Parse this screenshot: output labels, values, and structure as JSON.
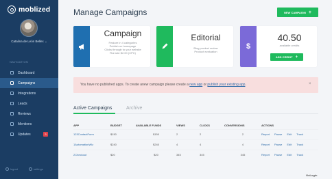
{
  "app": {
    "name": "moblized"
  },
  "user": {
    "name": "Catalina de León Bellec"
  },
  "nav": {
    "header": "NAVIGATION",
    "items": [
      {
        "label": "Dashboard"
      },
      {
        "label": "Campaigns"
      },
      {
        "label": "Integrations"
      },
      {
        "label": "Leads"
      },
      {
        "label": "Reviews"
      },
      {
        "label": "Mentions"
      },
      {
        "label": "Updates",
        "badge": "3"
      }
    ],
    "footer": {
      "logout": "logout",
      "settings": "settings"
    }
  },
  "page": {
    "title": "Manage Campaigns"
  },
  "toolbar": {
    "new_campaign": "NEW CAMPAIGN"
  },
  "cards": {
    "campaign": {
      "title": "Campaign",
      "lines": [
        "Feature in 4 categories",
        "Publish on homepage",
        "Clicks through to your website",
        "Flat rate $2.00 (CPC)"
      ]
    },
    "editorial": {
      "title": "Editorial",
      "lines": [
        "Blog product review",
        "Product evaluation"
      ]
    },
    "credit": {
      "amount": "40.50",
      "subtitle": "available credits",
      "button": "ADD CREDIT",
      "symbol": "$"
    }
  },
  "alert": {
    "prefix": "You have no published apps. To create anew campaign please create a",
    "link1": "new app",
    "middle": "or",
    "link2": "publish your existing app",
    "suffix": ".",
    "close": "×"
  },
  "tabs": {
    "active": "Active Campaigns",
    "archive": "Archive"
  },
  "table": {
    "headers": [
      "APP",
      "BUDGET",
      "AVAILABLE FUNDS",
      "VIEWS",
      "CLICKS",
      "CONVERSIONS",
      "ACTIONS"
    ],
    "rows": [
      {
        "app": "123ContactForm",
        "budget": "$150",
        "funds": "$150",
        "views": "2",
        "clicks": "2",
        "conversions": "2"
      },
      {
        "app": "1AutomationWiz",
        "budget": "$240",
        "funds": "$240",
        "views": "4",
        "clicks": "4",
        "conversions": "4"
      },
      {
        "app": "2Checkout",
        "budget": "$20",
        "funds": "$20",
        "views": "345",
        "clicks": "345",
        "conversions": "345"
      }
    ],
    "actions": [
      "Report",
      "Pause",
      "Edit",
      "Track"
    ]
  },
  "watermark": "GoLogin"
}
